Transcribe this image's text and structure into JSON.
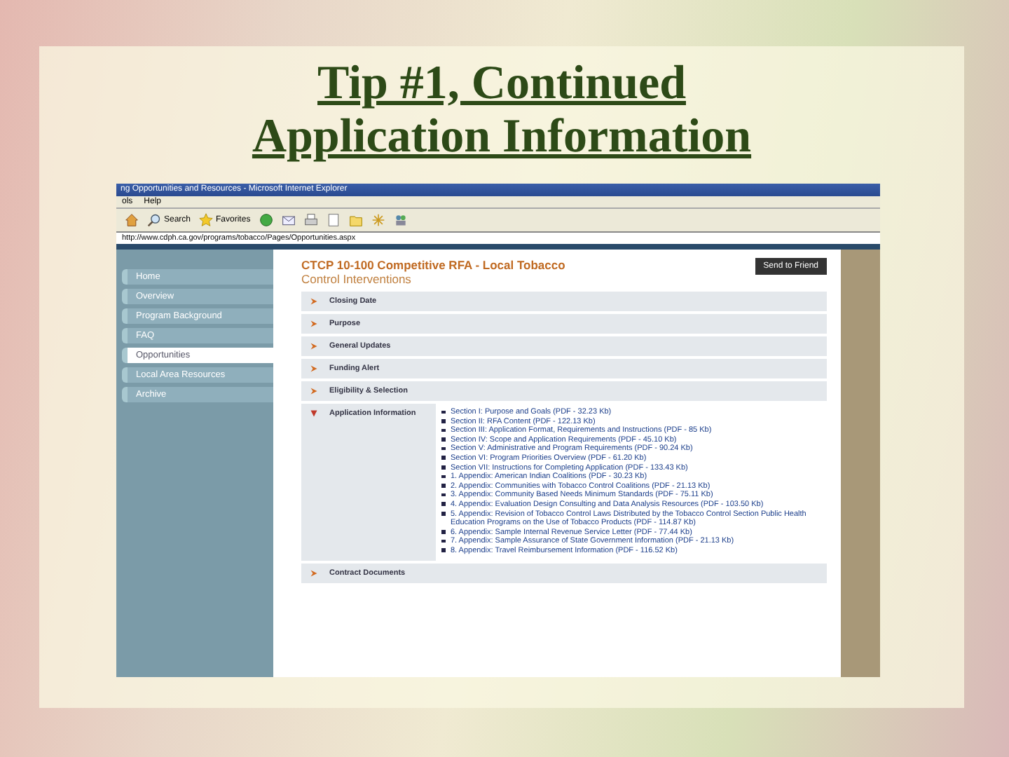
{
  "slide": {
    "title_lines": [
      "Tip #1, Continued",
      "Application Information"
    ]
  },
  "browser": {
    "title": "ng Opportunities and Resources - Microsoft Internet Explorer",
    "menu": [
      "ols",
      "Help"
    ],
    "toolbar": [
      {
        "kind": "home"
      },
      {
        "kind": "search",
        "label": "Search"
      },
      {
        "kind": "favorites",
        "label": "Favorites"
      },
      {
        "kind": "media"
      },
      {
        "kind": "mail"
      },
      {
        "kind": "print"
      },
      {
        "kind": "edit"
      },
      {
        "kind": "folder"
      },
      {
        "kind": "star"
      },
      {
        "kind": "messenger"
      }
    ],
    "address": "http://www.cdph.ca.gov/programs/tobacco/Pages/Opportunities.aspx"
  },
  "sidebar": {
    "items": [
      {
        "label": "Home",
        "selected": false
      },
      {
        "label": "Overview",
        "selected": false
      },
      {
        "label": "Program Background",
        "selected": false
      },
      {
        "label": "FAQ",
        "selected": false
      },
      {
        "label": "Opportunities",
        "selected": true
      },
      {
        "label": "Local Area Resources",
        "selected": false
      },
      {
        "label": "Archive",
        "selected": false
      }
    ]
  },
  "page": {
    "heading_lines": [
      "CTCP 10-100 Competitive RFA - Local Tobacco",
      "Control Interventions"
    ],
    "button": "Send to Friend",
    "sections": [
      {
        "title": "Closing Date",
        "expanded": false
      },
      {
        "title": "Purpose",
        "expanded": false
      },
      {
        "title": "General Updates",
        "expanded": false
      },
      {
        "title": "Funding Alert",
        "expanded": false
      },
      {
        "title": "Eligibility & Selection",
        "expanded": false
      },
      {
        "title": "Application Information",
        "expanded": true,
        "links": [
          "Section I: Purpose and Goals (PDF - 32.23 Kb)",
          "Section II: RFA Content (PDF - 122.13 Kb)",
          "Section III: Application Format, Requirements and Instructions (PDF - 85 Kb)",
          "Section IV: Scope and Application Requirements (PDF - 45.10 Kb)",
          "Section V: Administrative and Program Requirements (PDF - 90.24 Kb)",
          "Section VI: Program Priorities Overview (PDF - 61.20 Kb)",
          "Section VII: Instructions for Completing Application (PDF - 133.43 Kb)",
          "1. Appendix: American Indian Coalitions (PDF - 30.23 Kb)",
          "2. Appendix: Communities with Tobacco Control Coalitions (PDF - 21.13 Kb)",
          "3. Appendix: Community Based Needs Minimum Standards (PDF - 75.11 Kb)",
          "4. Appendix: Evaluation Design Consulting and Data Analysis Resources (PDF - 103.50 Kb)",
          "5. Appendix: Revision of Tobacco Control Laws Distributed by the Tobacco Control Section Public Health Education Programs on the Use of Tobacco Products (PDF - 114.87 Kb)",
          "6. Appendix: Sample Internal Revenue Service Letter (PDF - 77.44 Kb)",
          "7. Appendix: Sample Assurance of State Government Information (PDF - 21.13 Kb)",
          "8. Appendix: Travel Reimbursement Information (PDF - 116.52 Kb)"
        ]
      },
      {
        "title": "Contract Documents",
        "expanded": false
      }
    ]
  }
}
